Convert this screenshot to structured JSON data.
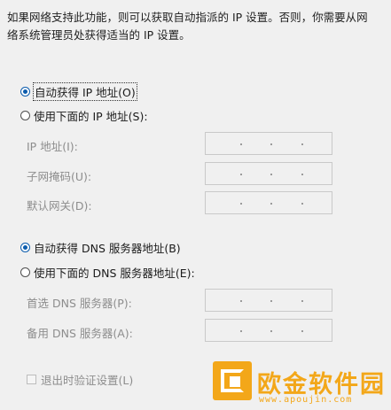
{
  "description": {
    "line1": "如果网络支持此功能，则可以获取自动指派的 IP 设置。否则，你需要从网",
    "line2": "络系统管理员处获得适当的 IP 设置。"
  },
  "ip_section": {
    "auto_option": "自动获得 IP 地址(O)",
    "manual_option": "使用下面的 IP 地址(S):",
    "auto_selected": true,
    "fields": [
      {
        "label": "IP 地址(I):"
      },
      {
        "label": "子网掩码(U):"
      },
      {
        "label": "默认网关(D):"
      }
    ]
  },
  "dns_section": {
    "auto_option": "自动获得 DNS 服务器地址(B)",
    "manual_option": "使用下面的 DNS 服务器地址(E):",
    "auto_selected": true,
    "fields": [
      {
        "label": "首选 DNS 服务器(P):"
      },
      {
        "label": "备用 DNS 服务器(A):"
      }
    ]
  },
  "validate_checkbox": {
    "label": "退出时验证设置(L)",
    "checked": false
  },
  "watermark": {
    "title": "欧金软件园",
    "url": "www.apoujin.com",
    "color": "#f3a719"
  },
  "colors": {
    "radio_accent": "#0b5cad",
    "disabled_text": "#8d8d8d",
    "background": "#f0f0f0"
  }
}
